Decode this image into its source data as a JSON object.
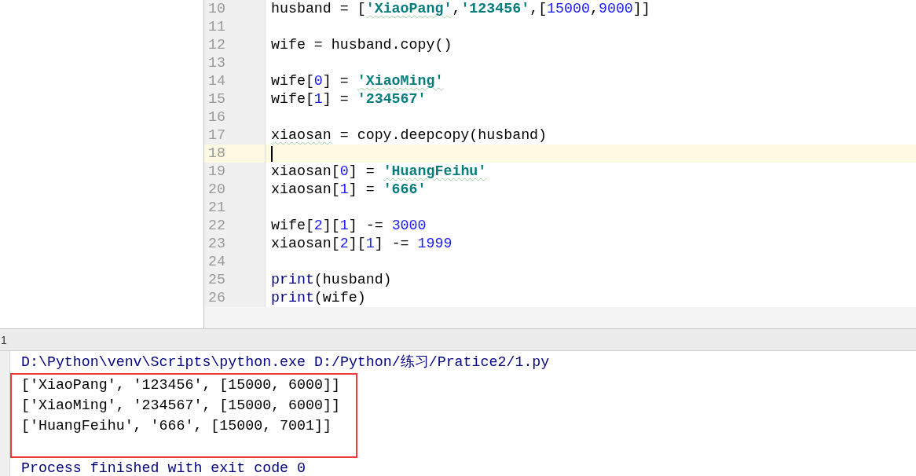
{
  "editor": {
    "lines": [
      {
        "number": "10",
        "current": false,
        "tokens": [
          {
            "kind": "plain",
            "text": "husband = ["
          },
          {
            "kind": "string",
            "text": "'XiaoPang'",
            "typo": true
          },
          {
            "kind": "plain",
            "text": ","
          },
          {
            "kind": "string",
            "text": "'123456'"
          },
          {
            "kind": "plain",
            "text": ",["
          },
          {
            "kind": "number",
            "text": "15000"
          },
          {
            "kind": "plain",
            "text": ","
          },
          {
            "kind": "number",
            "text": "9000"
          },
          {
            "kind": "plain",
            "text": "]]"
          }
        ]
      },
      {
        "number": "11",
        "current": false
      },
      {
        "number": "12",
        "current": false,
        "tokens": [
          {
            "kind": "plain",
            "text": "wife = husband.copy()"
          }
        ]
      },
      {
        "number": "13",
        "current": false
      },
      {
        "number": "14",
        "current": false,
        "tokens": [
          {
            "kind": "plain",
            "text": "wife["
          },
          {
            "kind": "number",
            "text": "0"
          },
          {
            "kind": "plain",
            "text": "] = "
          },
          {
            "kind": "string",
            "text": "'XiaoMing'",
            "typo": true
          }
        ]
      },
      {
        "number": "15",
        "current": false,
        "tokens": [
          {
            "kind": "plain",
            "text": "wife["
          },
          {
            "kind": "number",
            "text": "1"
          },
          {
            "kind": "plain",
            "text": "] = "
          },
          {
            "kind": "string",
            "text": "'234567'"
          }
        ]
      },
      {
        "number": "16",
        "current": false
      },
      {
        "number": "17",
        "current": false,
        "tokens": [
          {
            "kind": "plain",
            "text": "xiaosan",
            "typo": true
          },
          {
            "kind": "plain",
            "text": " = copy.deepcopy(husband)"
          }
        ]
      },
      {
        "number": "18",
        "current": true
      },
      {
        "number": "19",
        "current": false,
        "tokens": [
          {
            "kind": "plain",
            "text": "xiaosan["
          },
          {
            "kind": "number",
            "text": "0"
          },
          {
            "kind": "plain",
            "text": "] = "
          },
          {
            "kind": "string",
            "text": "'HuangFeihu'",
            "typo": true
          }
        ]
      },
      {
        "number": "20",
        "current": false,
        "tokens": [
          {
            "kind": "plain",
            "text": "xiaosan["
          },
          {
            "kind": "number",
            "text": "1"
          },
          {
            "kind": "plain",
            "text": "] = "
          },
          {
            "kind": "string",
            "text": "'666'"
          }
        ]
      },
      {
        "number": "21",
        "current": false
      },
      {
        "number": "22",
        "current": false,
        "tokens": [
          {
            "kind": "plain",
            "text": "wife["
          },
          {
            "kind": "number",
            "text": "2"
          },
          {
            "kind": "plain",
            "text": "]["
          },
          {
            "kind": "number",
            "text": "1"
          },
          {
            "kind": "plain",
            "text": "] -= "
          },
          {
            "kind": "number",
            "text": "3000"
          }
        ]
      },
      {
        "number": "23",
        "current": false,
        "tokens": [
          {
            "kind": "plain",
            "text": "xiaosan["
          },
          {
            "kind": "number",
            "text": "2"
          },
          {
            "kind": "plain",
            "text": "]["
          },
          {
            "kind": "number",
            "text": "1"
          },
          {
            "kind": "plain",
            "text": "] -= "
          },
          {
            "kind": "number",
            "text": "1999"
          }
        ]
      },
      {
        "number": "24",
        "current": false
      },
      {
        "number": "25",
        "current": false,
        "tokens": [
          {
            "kind": "builtin",
            "text": "print"
          },
          {
            "kind": "plain",
            "text": "(husband)"
          }
        ]
      },
      {
        "number": "26",
        "current": false,
        "tokens": [
          {
            "kind": "builtin",
            "text": "print"
          },
          {
            "kind": "plain",
            "text": "(wife)"
          }
        ]
      }
    ]
  },
  "tool_window": {
    "tab": "1"
  },
  "console": {
    "command": "D:\\Python\\venv\\Scripts\\python.exe D:/Python/练习/Pratice2/1.py",
    "highlighted_output": [
      "['XiaoPang', '123456', [15000, 6000]]",
      "['XiaoMing', '234567', [15000, 6000]]",
      "['HuangFeihu', '666', [15000, 7001]]"
    ],
    "exit_message": "Process finished with exit code 0"
  }
}
